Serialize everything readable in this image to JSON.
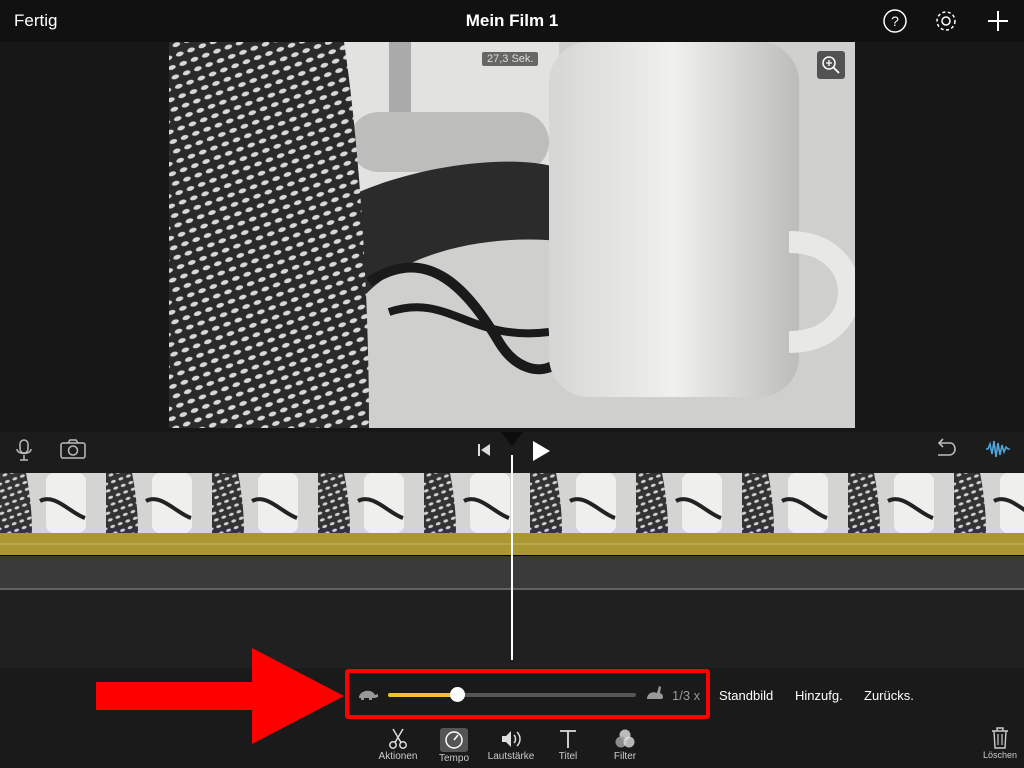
{
  "topbar": {
    "done_label": "Fertig",
    "title": "Mein Film 1",
    "icons": [
      "help-icon",
      "gear-icon",
      "plus-icon"
    ]
  },
  "preview": {
    "duration_badge": "27,3 Sek.",
    "zoom_icon": "zoom-in-icon"
  },
  "controls": {
    "icons": [
      "microphone-icon",
      "camera-icon",
      "skip-to-start-icon",
      "play-icon",
      "undo-icon",
      "waveform-icon"
    ],
    "accent_color": "#4ea6dc"
  },
  "speed_panel": {
    "slow_icon": "turtle-icon",
    "fast_icon": "rabbit-icon",
    "value_label": "1/3 x",
    "slider_value_fraction": 0.28,
    "highlight_color": "#ff0000",
    "slider_color": "#f2c22b"
  },
  "actions": {
    "freeze_label": "Standbild",
    "add_label": "Hinzufg.",
    "reset_label": "Zurücks."
  },
  "toolbar": {
    "tools": [
      {
        "label": "Aktionen",
        "icon": "scissors-icon"
      },
      {
        "label": "Tempo",
        "icon": "speedometer-icon"
      },
      {
        "label": "Lautstärke",
        "icon": "speaker-icon"
      },
      {
        "label": "Titel",
        "icon": "title-icon"
      },
      {
        "label": "Filter",
        "icon": "filter-icon"
      }
    ],
    "delete_label": "Löschen"
  }
}
